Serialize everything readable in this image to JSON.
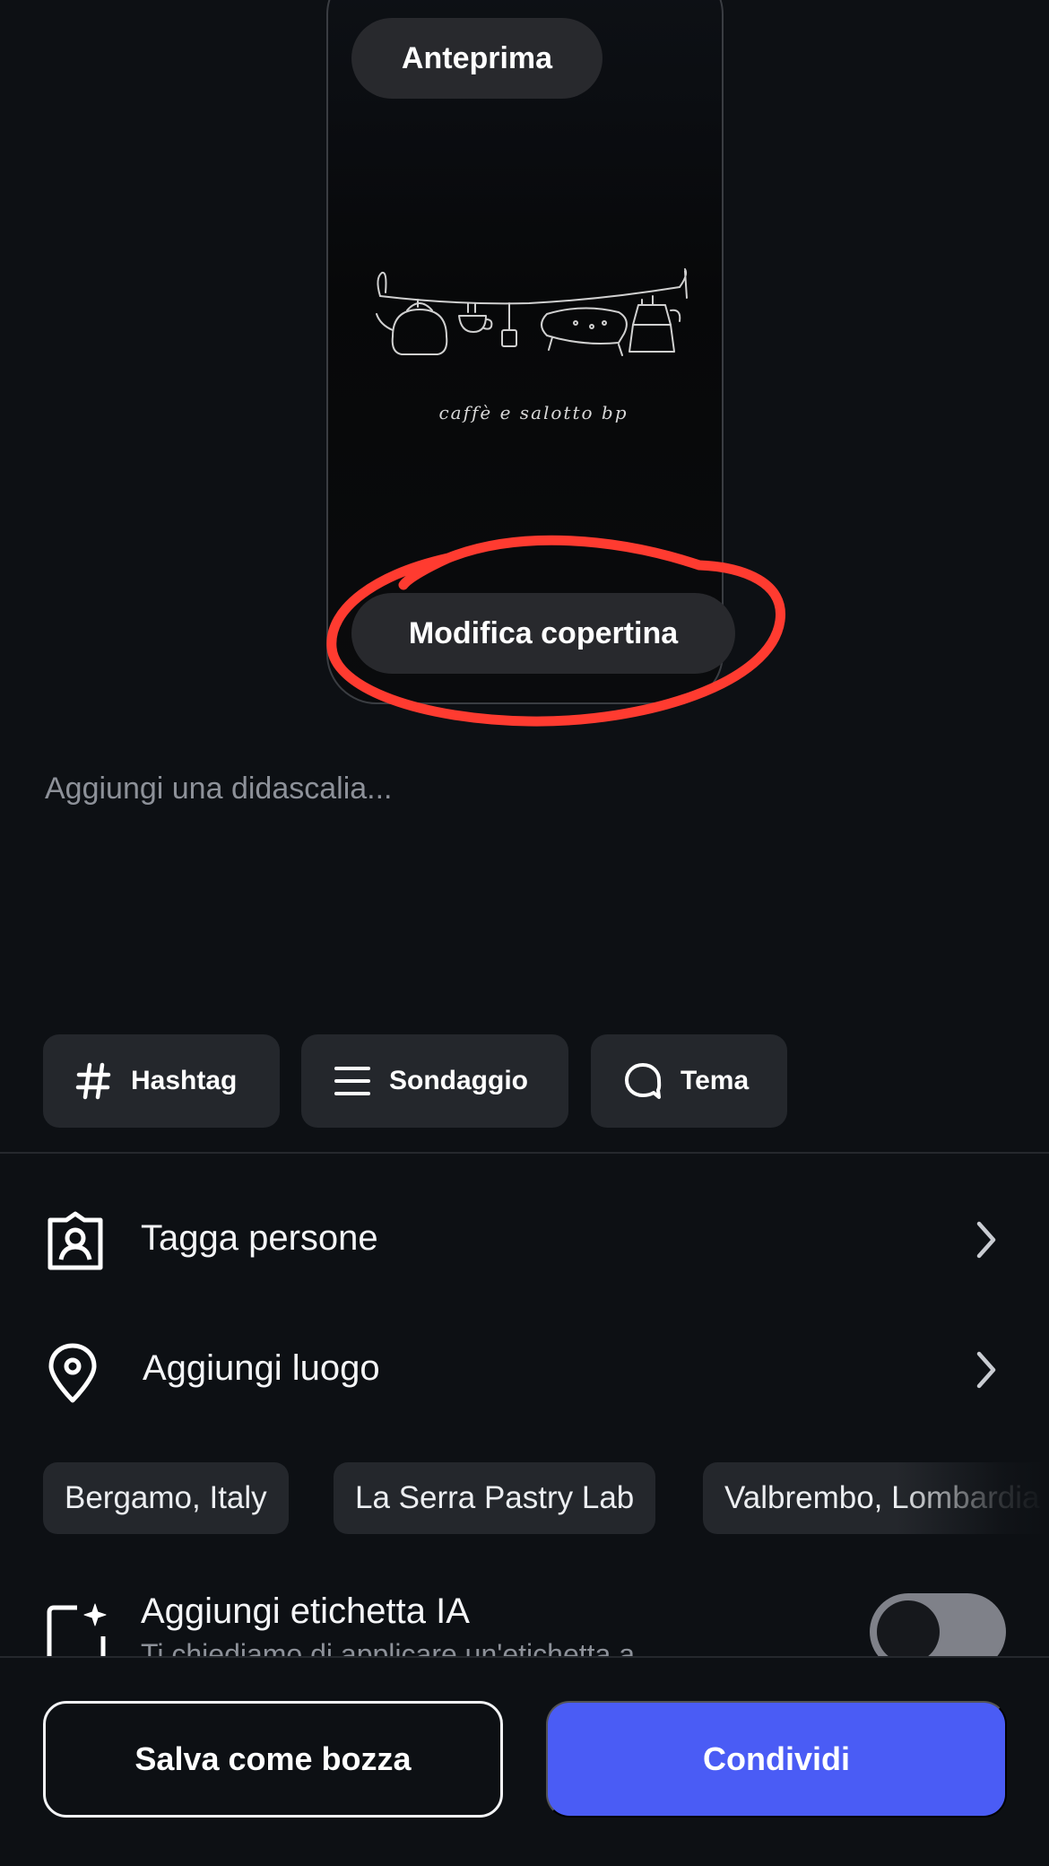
{
  "preview": {
    "preview_label": "Anteprima",
    "edit_cover_label": "Modifica copertina",
    "cover_caption": "caffè e salotto bp"
  },
  "caption": {
    "placeholder": "Aggiungi una didascalia..."
  },
  "chips": [
    {
      "label": "Hashtag",
      "icon": "hashtag-icon"
    },
    {
      "label": "Sondaggio",
      "icon": "list-icon"
    },
    {
      "label": "Tema",
      "icon": "speech-bubble-icon"
    }
  ],
  "rows": {
    "tag_people": "Tagga persone",
    "add_location": "Aggiungi luogo"
  },
  "location_suggestions": [
    "Bergamo, Italy",
    "La Serra Pastry Lab",
    "Valbrembo, Lombardia"
  ],
  "ai_label": {
    "title": "Aggiungi etichetta IA",
    "subtitle": "Ti chiediamo di applicare un'etichetta a",
    "enabled": false
  },
  "actions": {
    "draft_label": "Salva come bozza",
    "share_label": "Condividi"
  },
  "colors": {
    "background": "#0d1014",
    "accent": "#4a5cf5",
    "annotation": "#ff3b30"
  }
}
